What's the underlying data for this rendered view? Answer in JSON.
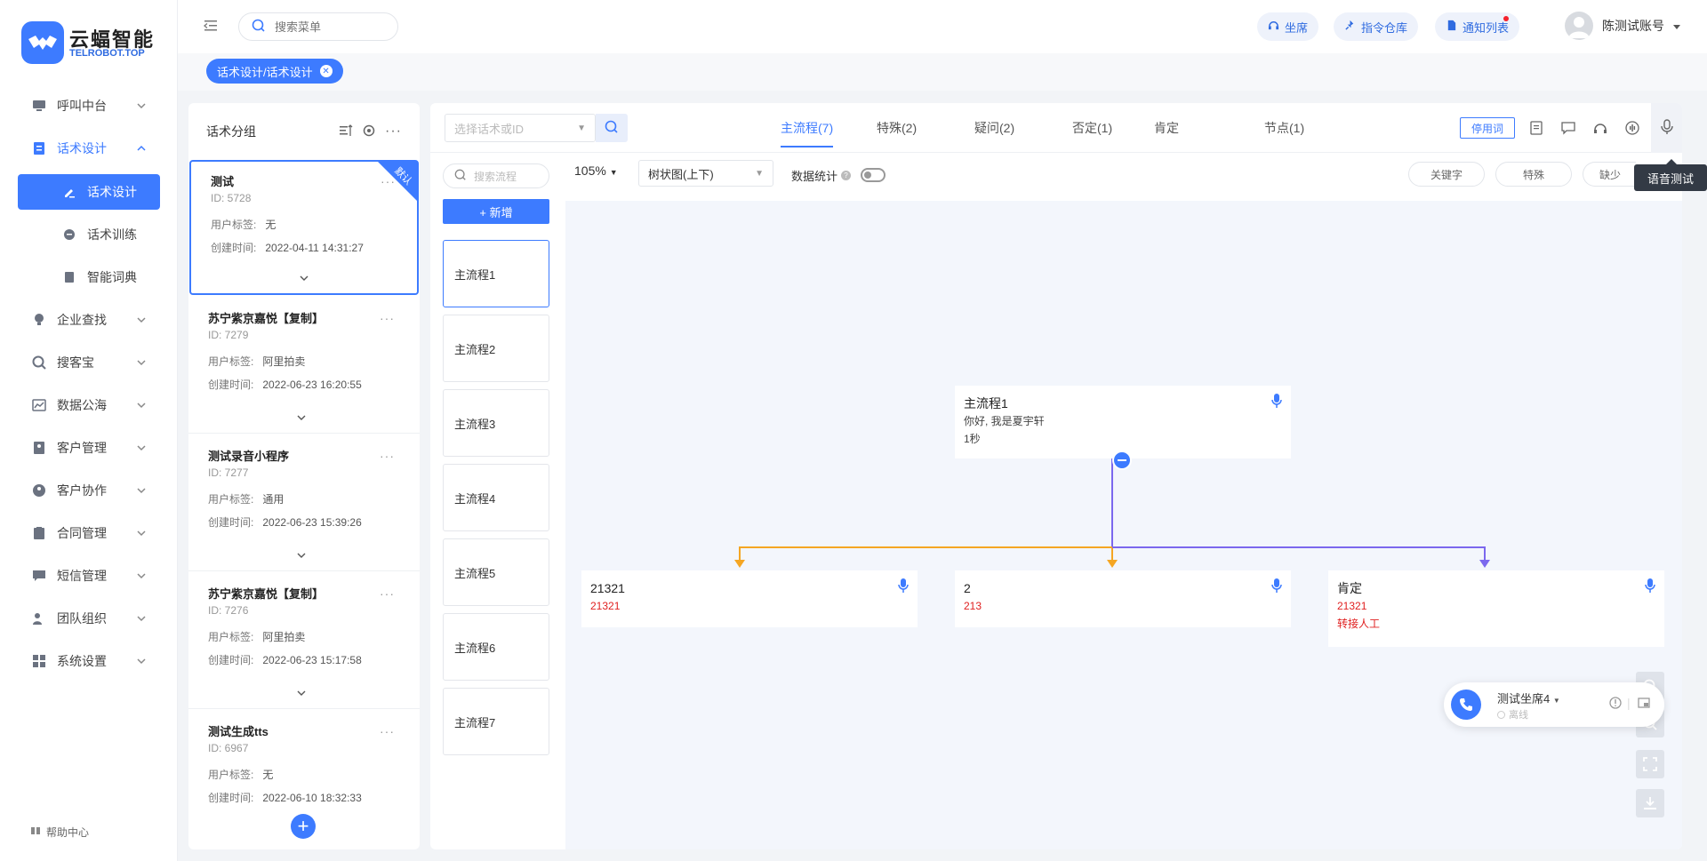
{
  "brand": {
    "name": "云蝠智能",
    "domain": "TELROBOT.TOP",
    "accent": "#3d7bff"
  },
  "sidebar": {
    "items": [
      {
        "label": "呼叫中台",
        "icon": "monitor-icon"
      },
      {
        "label": "话术设计",
        "icon": "document-icon"
      },
      {
        "label": "话术设计",
        "icon": "edit-icon"
      },
      {
        "label": "话术训练",
        "icon": "chat-icon"
      },
      {
        "label": "智能词典",
        "icon": "book-icon"
      },
      {
        "label": "企业查找",
        "icon": "bulb-icon"
      },
      {
        "label": "搜客宝",
        "icon": "search-user-icon"
      },
      {
        "label": "数据公海",
        "icon": "chart-icon"
      },
      {
        "label": "客户管理",
        "icon": "contacts-icon"
      },
      {
        "label": "客户协作",
        "icon": "team-icon"
      },
      {
        "label": "合同管理",
        "icon": "clipboard-icon"
      },
      {
        "label": "短信管理",
        "icon": "message-icon"
      },
      {
        "label": "团队组织",
        "icon": "org-icon"
      },
      {
        "label": "系统设置",
        "icon": "settings-grid-icon"
      }
    ],
    "help": "帮助中心"
  },
  "header": {
    "search_placeholder": "搜索菜单",
    "seat_btn": "坐席",
    "command_btn": "指令仓库",
    "notice_btn": "通知列表",
    "user": "陈测试账号"
  },
  "tabs": {
    "active": "话术设计/话术设计"
  },
  "groups": {
    "title": "话术分组",
    "label_key": "用户标签:",
    "time_key": "创建时间:",
    "default_badge": "默认",
    "cards": [
      {
        "name": "测试",
        "id": "ID: 5728",
        "tag": "无",
        "time": "2022-04-11 14:31:27"
      },
      {
        "name": "苏宁紫京嘉悦【复制】",
        "id": "ID: 7279",
        "tag": "阿里拍卖",
        "time": "2022-06-23 16:20:55"
      },
      {
        "name": "测试录音小程序",
        "id": "ID: 7277",
        "tag": "通用",
        "time": "2022-06-23 15:39:26"
      },
      {
        "name": "苏宁紫京嘉悦【复制】",
        "id": "ID: 7276",
        "tag": "阿里拍卖",
        "time": "2022-06-23 15:17:58"
      },
      {
        "name": "测试生成tts",
        "id": "ID: 6967",
        "tag": "无",
        "time": "2022-06-10 18:32:33"
      }
    ]
  },
  "main": {
    "script_placeholder": "选择话术或ID",
    "flow_tabs": [
      "主流程(7)",
      "特殊(2)",
      "疑问(2)",
      "否定(1)",
      "肯定",
      "节点(1)"
    ],
    "stop_words": "停用词",
    "tooltip": "语音测试",
    "flow_search": "搜索流程",
    "add_flow": "+ 新增",
    "flows": [
      "主流程1",
      "主流程2",
      "主流程3",
      "主流程4",
      "主流程5",
      "主流程6",
      "主流程7"
    ],
    "zoom": "105%",
    "view": "树状图(上下)",
    "stats": "数据统计",
    "chips": [
      "关键字",
      "特殊",
      "缺少"
    ]
  },
  "canvas": {
    "root": {
      "title": "主流程1",
      "line1": "你好, 我是夏宇轩",
      "line2": "1秒"
    },
    "children": [
      {
        "title": "21321",
        "line1": "21321",
        "line2": ""
      },
      {
        "title": "2",
        "line1": "213",
        "line2": ""
      },
      {
        "title": "肯定",
        "line1": "21321",
        "line2": "转接人工"
      }
    ],
    "edge_colors": {
      "orange": "#f5a623",
      "purple": "#7b68ee"
    }
  },
  "seat": {
    "name": "测试坐席4",
    "status": "离线"
  }
}
